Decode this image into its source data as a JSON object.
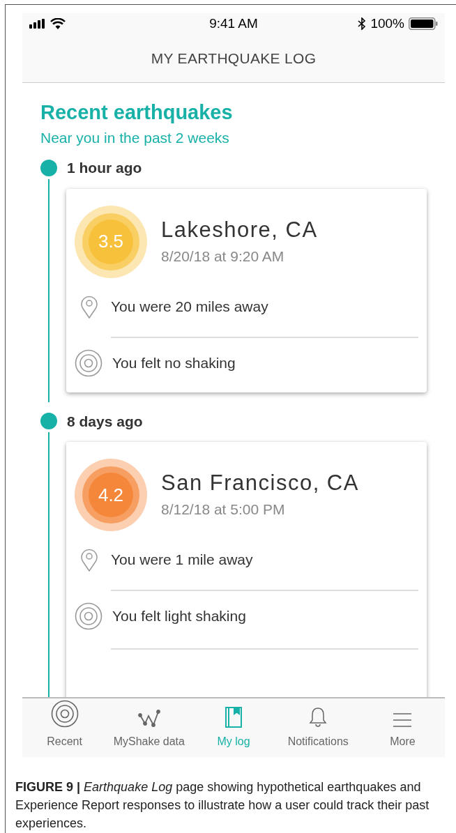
{
  "status_bar": {
    "time": "9:41 AM",
    "battery": "100%"
  },
  "header": {
    "title": "MY EARTHQUAKE LOG"
  },
  "section": {
    "title": "Recent earthquakes",
    "subtitle": "Near you in the past 2 weeks"
  },
  "quakes": [
    {
      "when": "1 hour ago",
      "magnitude": "3.5",
      "color": "#f8c13c",
      "place": "Lakeshore, CA",
      "date": "8/20/18 at 9:20 AM",
      "distance": "You were 20 miles away",
      "shaking": "You felt no shaking"
    },
    {
      "when": "8 days ago",
      "magnitude": "4.2",
      "color": "#f5873a",
      "place": "San Francisco, CA",
      "date": "8/12/18 at 5:00 PM",
      "distance": "You were 1 mile away",
      "shaking": "You felt light shaking"
    }
  ],
  "tabs": [
    {
      "label": "Recent",
      "kind": "rings",
      "selected": false
    },
    {
      "label": "MyShake data",
      "kind": "wave",
      "selected": false
    },
    {
      "label": "My log",
      "kind": "book",
      "selected": true
    },
    {
      "label": "Notifications",
      "kind": "bell",
      "selected": false
    },
    {
      "label": "More",
      "kind": "menu",
      "selected": false
    }
  ],
  "caption": "**FIGURE 9 |** *Earthquake Log* page showing hypothetical earthquakes and Experience Report responses to illustrate how a user could track their past experiences."
}
